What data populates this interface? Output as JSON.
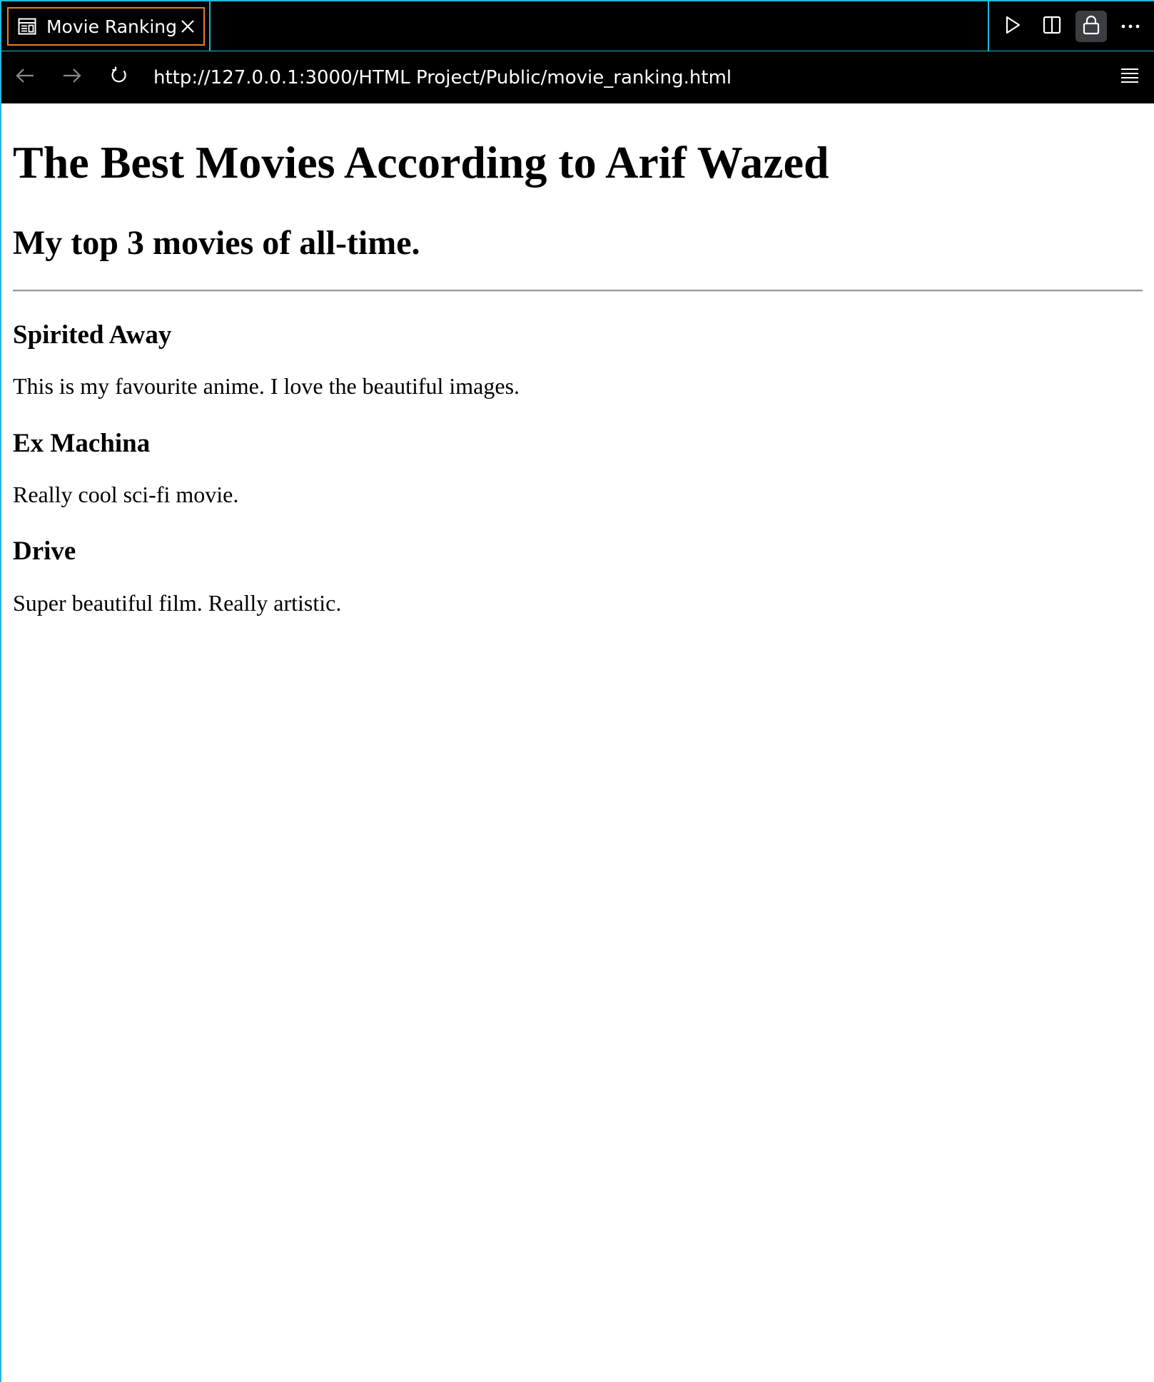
{
  "browser": {
    "tab": {
      "title": "Movie Ranking",
      "icon": "preview-icon"
    },
    "actions": [
      {
        "name": "run-icon"
      },
      {
        "name": "split-editor-icon"
      },
      {
        "name": "lock-icon",
        "active": true
      },
      {
        "name": "more-icon"
      }
    ],
    "url": "http://127.0.0.1:3000/HTML Project/Public/movie_ranking.html"
  },
  "page": {
    "title": "The Best Movies According to Arif Wazed",
    "subtitle": "My top 3 movies of all-time.",
    "movies": [
      {
        "name": "Spirited Away",
        "description": "This is my favourite anime. I love the beautiful images."
      },
      {
        "name": "Ex Machina",
        "description": "Really cool sci-fi movie."
      },
      {
        "name": "Drive",
        "description": "Super beautiful film. Really artistic."
      }
    ]
  },
  "colors": {
    "tab_border": "#e87d22",
    "window_border": "#23b8dc",
    "chrome_background": "#000000",
    "page_background": "#ffffff"
  }
}
